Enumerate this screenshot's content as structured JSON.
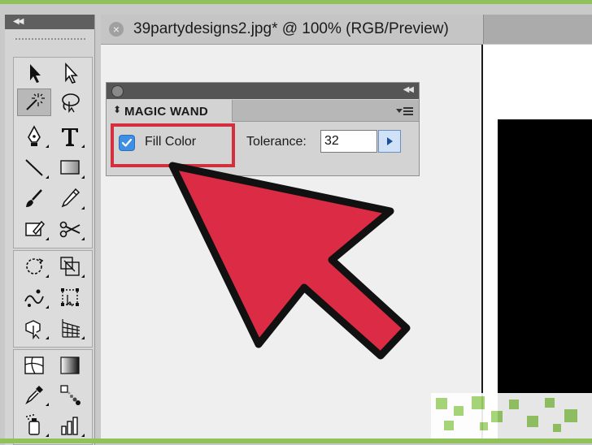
{
  "document": {
    "tab_title": "39partydesigns2.jpg* @ 100% (RGB/Preview)",
    "close_symbol": "×"
  },
  "panel": {
    "title": "MAGIC WAND",
    "fill_color_label": "Fill Color",
    "fill_color_checked": true,
    "tolerance_label": "Tolerance:",
    "tolerance_value": "32"
  },
  "tools": [
    {
      "name": "selection-tool-icon",
      "selected": false
    },
    {
      "name": "direct-selection-tool-icon",
      "selected": false
    },
    {
      "name": "magic-wand-tool-icon",
      "selected": true
    },
    {
      "name": "lasso-tool-icon",
      "selected": false
    },
    {
      "name": "pen-tool-icon",
      "selected": false
    },
    {
      "name": "type-tool-icon",
      "selected": false
    },
    {
      "name": "line-segment-tool-icon",
      "selected": false
    },
    {
      "name": "rectangle-tool-icon",
      "selected": false
    },
    {
      "name": "paintbrush-tool-icon",
      "selected": false
    },
    {
      "name": "pencil-tool-icon",
      "selected": false
    },
    {
      "name": "eraser-tool-icon",
      "selected": false
    },
    {
      "name": "scissors-tool-icon",
      "selected": false
    },
    {
      "name": "rotate-tool-icon",
      "selected": false
    },
    {
      "name": "scale-tool-icon",
      "selected": false
    },
    {
      "name": "warp-tool-icon",
      "selected": false
    },
    {
      "name": "free-transform-tool-icon",
      "selected": false
    },
    {
      "name": "shape-builder-tool-icon",
      "selected": false
    },
    {
      "name": "perspective-grid-tool-icon",
      "selected": false
    },
    {
      "name": "mesh-tool-icon",
      "selected": false
    },
    {
      "name": "gradient-tool-icon",
      "selected": false
    },
    {
      "name": "eyedropper-tool-icon",
      "selected": false
    },
    {
      "name": "blend-tool-icon",
      "selected": false
    },
    {
      "name": "symbol-sprayer-tool-icon",
      "selected": false
    },
    {
      "name": "column-graph-tool-icon",
      "selected": false
    }
  ],
  "colors": {
    "highlight_red": "#d32f3f",
    "arrow_red": "#dc2b44",
    "checkbox_blue": "#3e8fe4",
    "frame_green": "#8fc25a"
  }
}
